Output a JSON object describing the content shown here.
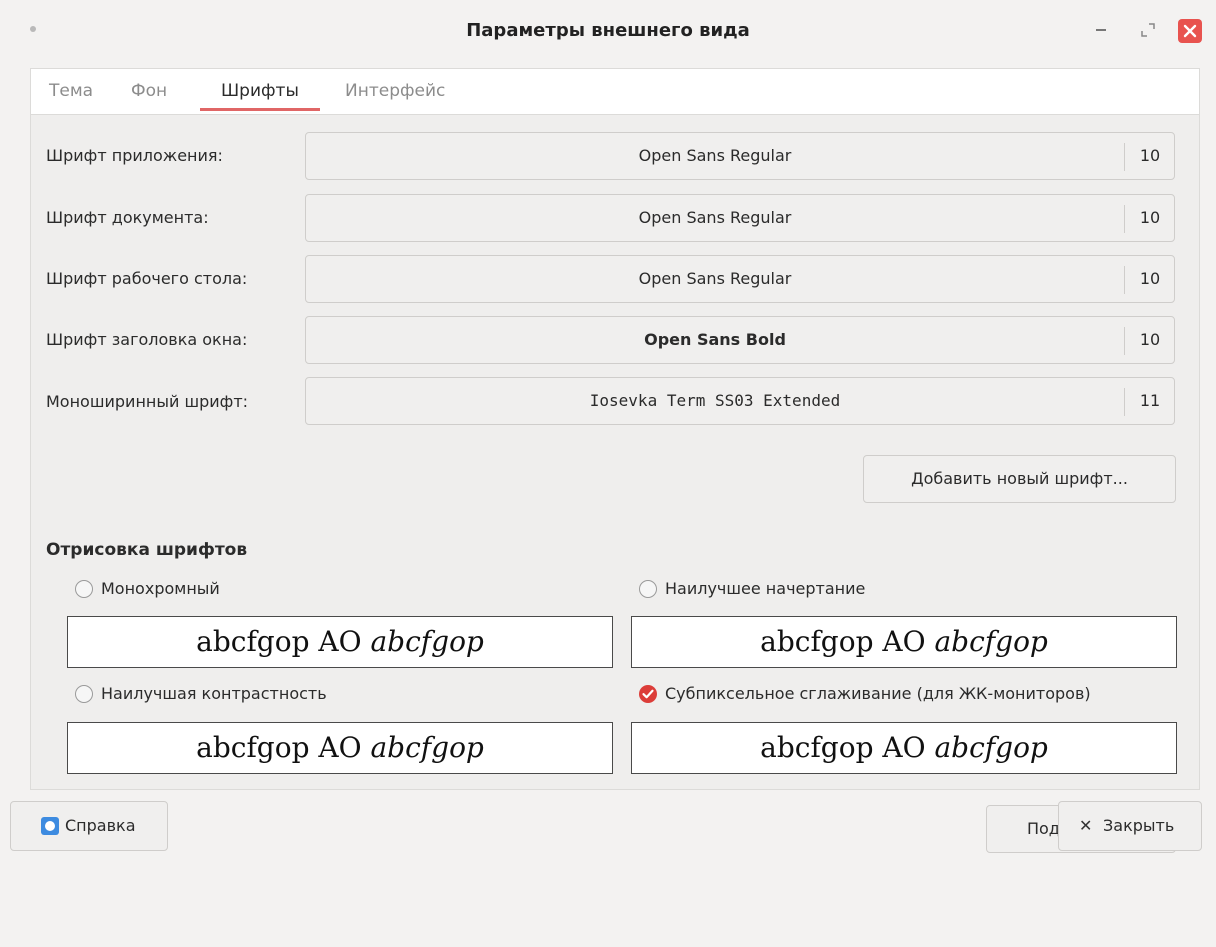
{
  "window": {
    "title": "Параметры внешнего вида"
  },
  "tabs": [
    {
      "label": "Тема"
    },
    {
      "label": "Фон"
    },
    {
      "label": "Шрифты",
      "active": true
    },
    {
      "label": "Интерфейс"
    }
  ],
  "fonts": [
    {
      "label": "Шрифт приложения:",
      "font": "Open Sans Regular",
      "size": "10"
    },
    {
      "label": "Шрифт документа:",
      "font": "Open Sans Regular",
      "size": "10"
    },
    {
      "label": "Шрифт рабочего стола:",
      "font": "Open Sans Regular",
      "size": "10"
    },
    {
      "label": "Шрифт заголовка окна:",
      "font": "Open Sans Bold",
      "size": "10"
    },
    {
      "label": "Моноширинный шрифт:",
      "font": "Iosevka Term SS03 Extended",
      "size": "11"
    }
  ],
  "add_font_button": "Добавить новый шрифт...",
  "rendering": {
    "title": "Отрисовка шрифтов",
    "preview_regular": "abcfgop AO ",
    "preview_italic": "abcfgop",
    "options": [
      {
        "label": "Монохромный",
        "checked": false
      },
      {
        "label": "Наилучшее начертание",
        "checked": false
      },
      {
        "label": "Наилучшая контрастность",
        "checked": false
      },
      {
        "label": "Субпиксельное сглаживание (для ЖК-мониторов)",
        "checked": true
      }
    ]
  },
  "details_button": "Подробнее...",
  "footer": {
    "help_label": "Справка",
    "close_label": "Закрыть"
  },
  "colors": {
    "accent": "#dc3d39",
    "tab_underline": "#e06666",
    "help_icon": "#3d8be0"
  }
}
